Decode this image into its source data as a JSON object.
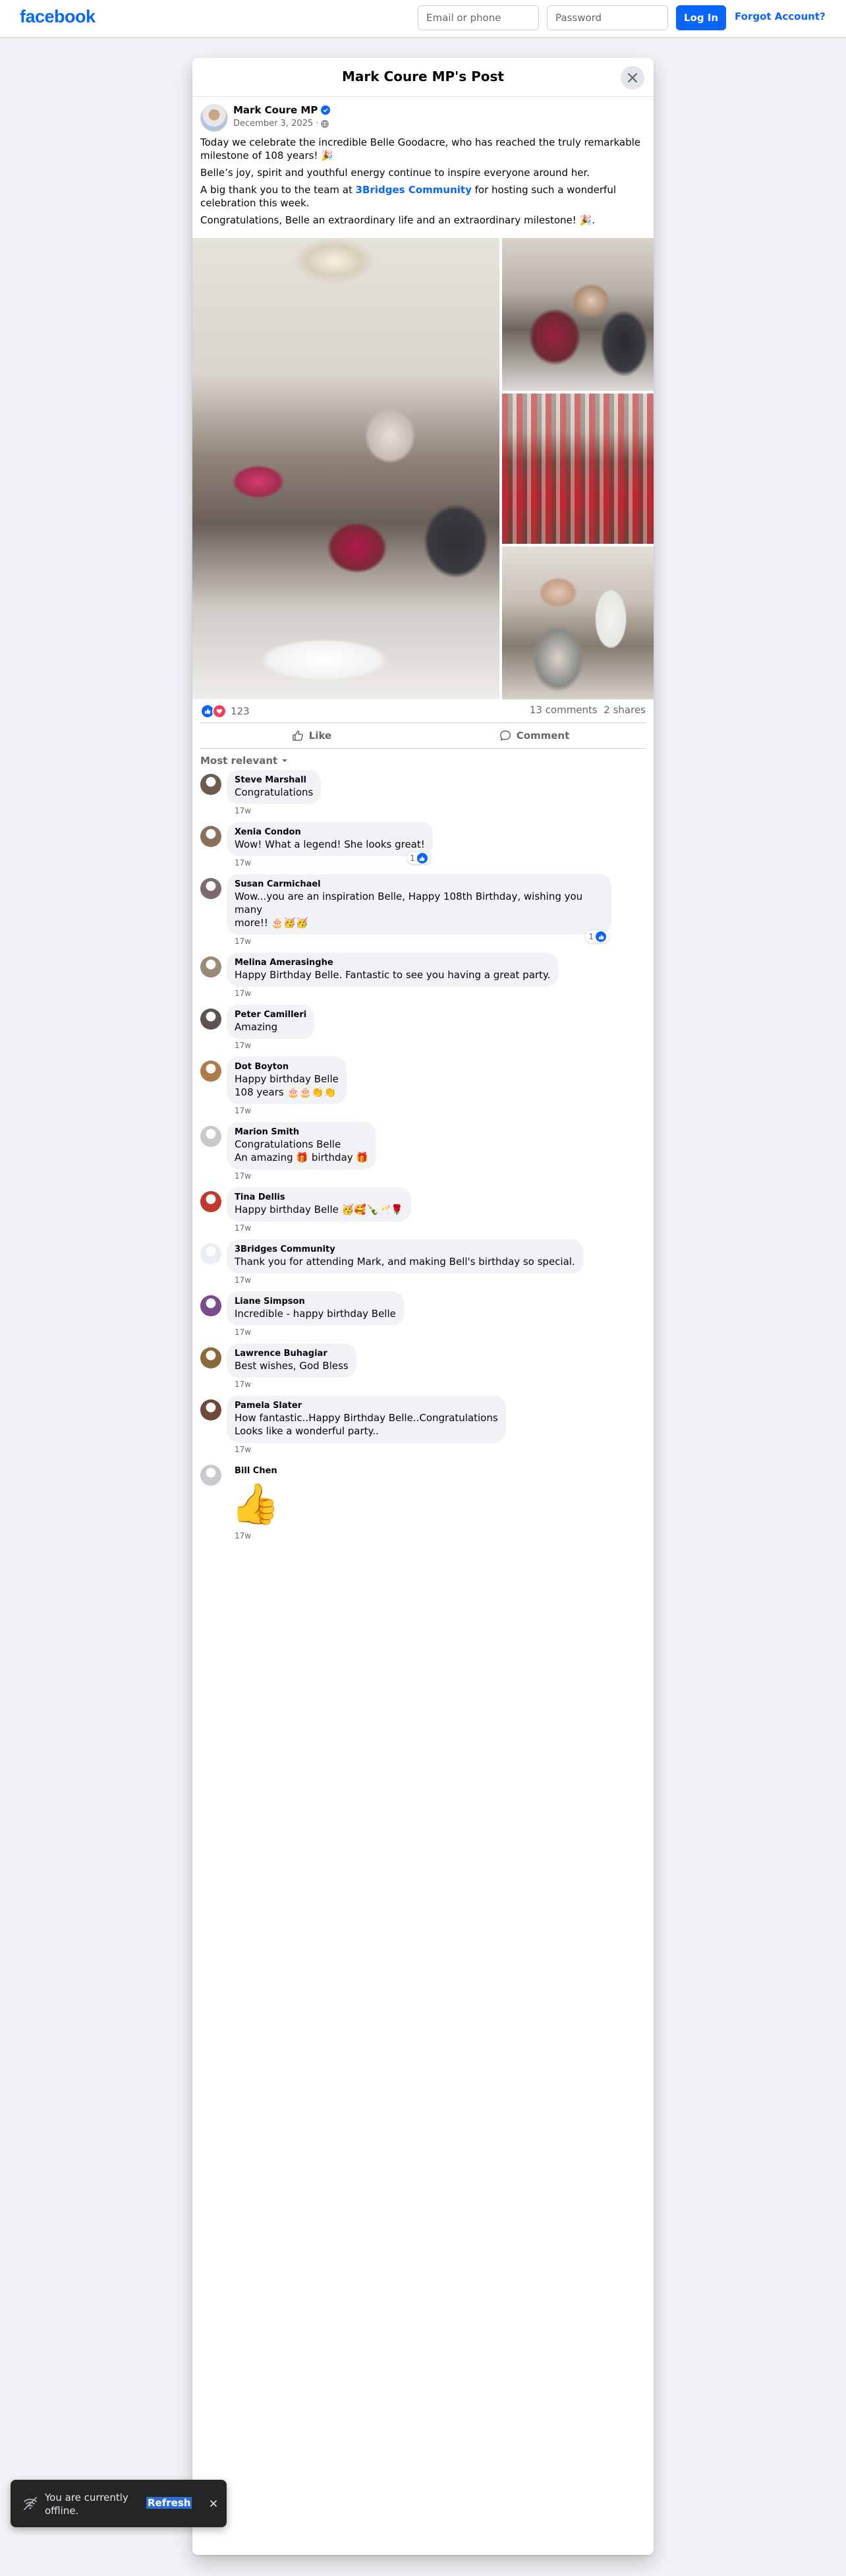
{
  "topbar": {
    "logo": "facebook",
    "email_placeholder": "Email or phone",
    "password_placeholder": "Password",
    "login_label": "Log In",
    "forgot_label": "Forgot Account?"
  },
  "dialog": {
    "title": "Mark Coure MP's Post"
  },
  "post": {
    "author": "Mark Coure MP",
    "date": "December 3, 2025",
    "separator": "·",
    "p1": "Today we celebrate the incredible Belle Goodacre, who has reached the truly remarkable milestone of 108 years! 🎉",
    "p2": "Belle’s joy, spirit and youthful energy continue to inspire everyone around her.",
    "p3_before": "A big thank you to the team at ",
    "p3_link": "3Bridges Community",
    "p3_after": " for hosting such a wonderful celebration this week.",
    "p4": "Congratulations, Belle an extraordinary life and an extraordinary milestone! 🎉.",
    "reaction_count": "123",
    "comments_count": "13 comments",
    "shares_count": "2 shares",
    "like_label": "Like",
    "comment_label": "Comment",
    "sort_label": "Most relevant"
  },
  "comments": [
    {
      "name": "Steve Marshall",
      "lines": [
        "Congratulations"
      ],
      "time": "17w"
    },
    {
      "name": "Xenia Condon",
      "lines": [
        "Wow! What a legend! She looks great!"
      ],
      "time": "17w",
      "reactions": "1"
    },
    {
      "name": "Susan Carmichael",
      "lines": [
        "Wow...you are an inspiration Belle, Happy 108th Birthday, wishing you many",
        "more!! 🎂🥳🥳"
      ],
      "time": "17w",
      "reactions": "1"
    },
    {
      "name": "Melina Amerasinghe",
      "lines": [
        "Happy Birthday Belle. Fantastic to see you having a great party."
      ],
      "time": "17w"
    },
    {
      "name": "Peter Camilleri",
      "lines": [
        "Amazing"
      ],
      "time": "17w"
    },
    {
      "name": "Dot Boyton",
      "lines": [
        "Happy birthday Belle",
        "108 years 🎂🎂👏👏"
      ],
      "time": "17w"
    },
    {
      "name": "Marion Smith",
      "lines": [
        "Congratulations Belle",
        "An amazing 🎁 birthday 🎁"
      ],
      "time": "17w"
    },
    {
      "name": "Tina Dellis",
      "lines": [
        "Happy birthday Belle 🥳🥰🍾🥂🌹"
      ],
      "time": "17w"
    },
    {
      "name": "3Bridges Community",
      "lines": [
        "Thank you for attending Mark, and making Bell's birthday so special."
      ],
      "time": "17w"
    },
    {
      "name": "Liane Simpson",
      "lines": [
        "Incredible - happy birthday Belle"
      ],
      "time": "17w"
    },
    {
      "name": "Lawrence Buhagiar",
      "lines": [
        "Best wishes, God Bless"
      ],
      "time": "17w"
    },
    {
      "name": "Pamela Slater",
      "lines": [
        "How fantastic..Happy Birthday Belle..Congratulations",
        "Looks like a wonderful party.."
      ],
      "time": "17w"
    },
    {
      "name": "Bill Chen",
      "sticker": "👍",
      "time": "17w"
    }
  ],
  "comment_avatar_colors": [
    "#6b5a4e",
    "#8a6f5c",
    "#7d6a70",
    "#9a8878",
    "#5a5350",
    "#b07a4a",
    "#c7c9cc",
    "#c0392b",
    "#e9eef5",
    "#7a4a8a",
    "#8b6a3a",
    "#6d4a3a",
    "#c7c9cc"
  ],
  "toast": {
    "message": "You are currently offline.",
    "refresh_label": "Refresh"
  },
  "colors": {
    "brand": "#0866ff",
    "background": "#f0f2f5",
    "like": "#0866ff",
    "love": "#f33e58"
  }
}
